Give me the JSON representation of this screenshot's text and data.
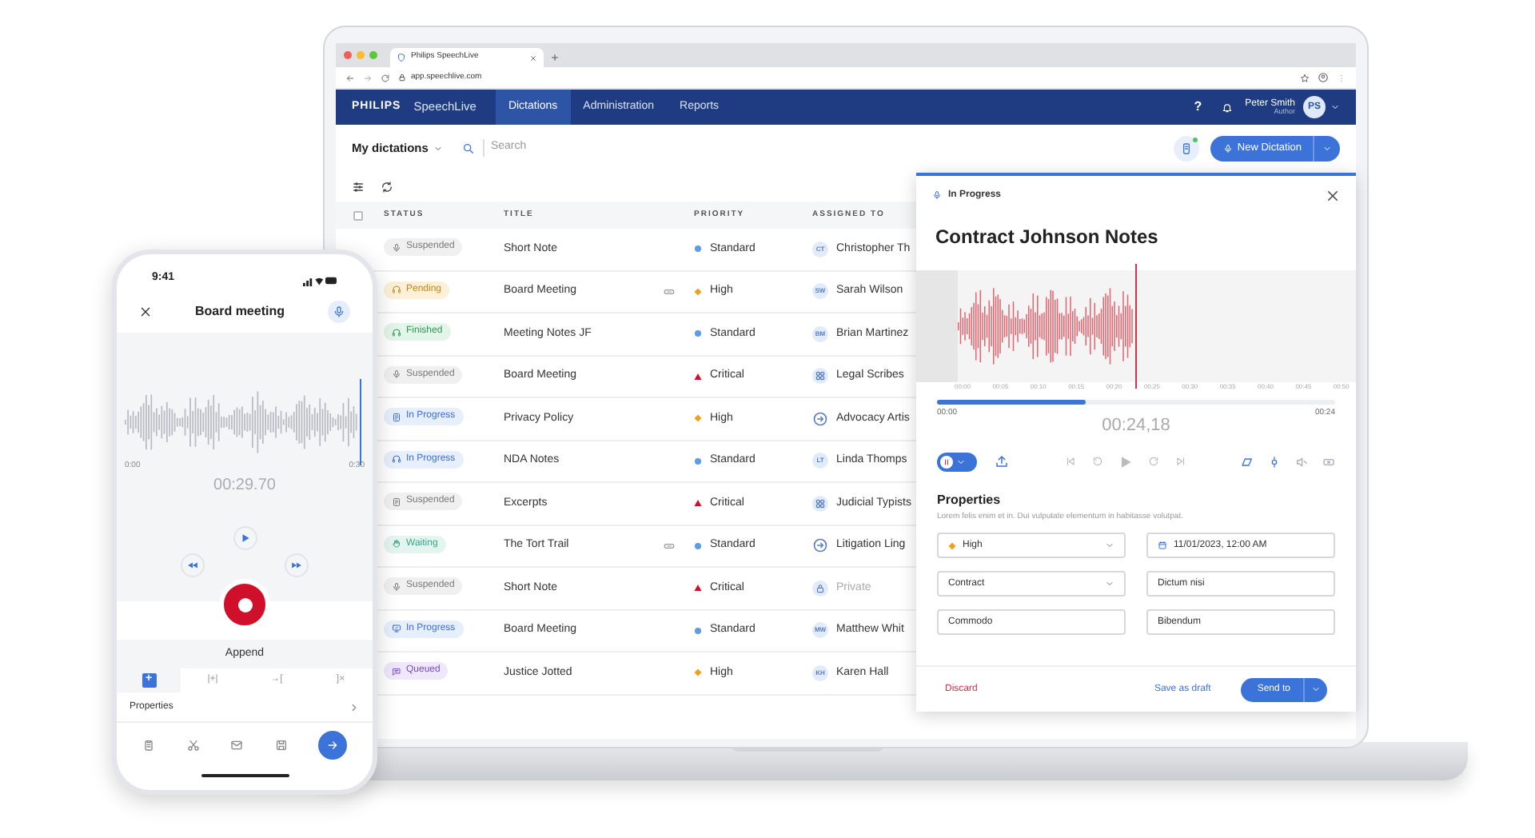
{
  "browser": {
    "tab_title": "Philips SpeechLive",
    "url": "app.speechlive.com"
  },
  "app_header": {
    "brand": "PHILIPS",
    "product": "SpeechLive",
    "nav": [
      {
        "label": "Dictations",
        "selected": true
      },
      {
        "label": "Administration",
        "selected": false
      },
      {
        "label": "Reports",
        "selected": false
      }
    ],
    "help": "?",
    "user": {
      "name": "Peter Smith",
      "role": "Author",
      "initials": "PS"
    }
  },
  "toolbar": {
    "view": "My dictations",
    "search": {
      "placeholder": "Search"
    },
    "new_button": "New Dictation"
  },
  "table": {
    "columns": [
      "STATUS",
      "TITLE",
      "PRIORITY",
      "ASSIGNED TO"
    ],
    "select_all_checked": false,
    "rows": [
      {
        "status": {
          "label": "Suspended",
          "kind": "suspended"
        },
        "title": "Short Note",
        "attachment": false,
        "priority": {
          "label": "Standard",
          "kind": "standard"
        },
        "assignee": {
          "kind": "person",
          "initials": "CT",
          "name": "Christopher Th"
        }
      },
      {
        "status": {
          "label": "Pending",
          "kind": "pending"
        },
        "title": "Board Meeting",
        "attachment": true,
        "priority": {
          "label": "High",
          "kind": "high"
        },
        "assignee": {
          "kind": "person",
          "initials": "SW",
          "name": "Sarah Wilson"
        }
      },
      {
        "status": {
          "label": "Finished",
          "kind": "finished"
        },
        "title": "Meeting Notes JF",
        "attachment": false,
        "priority": {
          "label": "Standard",
          "kind": "standard"
        },
        "assignee": {
          "kind": "person",
          "initials": "BM",
          "name": "Brian Martinez"
        }
      },
      {
        "status": {
          "label": "Suspended",
          "kind": "suspended"
        },
        "title": "Board Meeting",
        "attachment": false,
        "priority": {
          "label": "Critical",
          "kind": "critical"
        },
        "assignee": {
          "kind": "group",
          "name": "Legal Scribes"
        }
      },
      {
        "status": {
          "label": "In Progress",
          "kind": "in_progress"
        },
        "title": "Privacy Policy",
        "attachment": false,
        "priority": {
          "label": "High",
          "kind": "high"
        },
        "assignee": {
          "kind": "service",
          "name": "Advocacy Artis"
        }
      },
      {
        "status": {
          "label": "In Progress",
          "kind": "in_progress"
        },
        "title": "NDA Notes",
        "attachment": false,
        "priority": {
          "label": "Standard",
          "kind": "standard"
        },
        "assignee": {
          "kind": "person",
          "initials": "LT",
          "name": "Linda Thomps"
        }
      },
      {
        "status": {
          "label": "Suspended",
          "kind": "suspended"
        },
        "title": "Excerpts",
        "attachment": false,
        "priority": {
          "label": "Critical",
          "kind": "critical"
        },
        "assignee": {
          "kind": "group",
          "name": "Judicial Typists"
        }
      },
      {
        "status": {
          "label": "Waiting",
          "kind": "waiting"
        },
        "title": "The Tort Trail",
        "attachment": true,
        "priority": {
          "label": "Standard",
          "kind": "standard"
        },
        "assignee": {
          "kind": "service",
          "name": "Litigation Ling"
        }
      },
      {
        "status": {
          "label": "Suspended",
          "kind": "suspended"
        },
        "title": "Short Note",
        "attachment": false,
        "priority": {
          "label": "Critical",
          "kind": "critical"
        },
        "assignee": {
          "kind": "private",
          "name": "Private"
        }
      },
      {
        "status": {
          "label": "In Progress",
          "kind": "in_progress"
        },
        "title": "Board Meeting",
        "attachment": false,
        "priority": {
          "label": "Standard",
          "kind": "standard"
        },
        "assignee": {
          "kind": "person",
          "initials": "MW",
          "name": "Matthew Whit"
        }
      },
      {
        "status": {
          "label": "Queued",
          "kind": "queued"
        },
        "title": "Justice Jotted",
        "attachment": false,
        "priority": {
          "label": "High",
          "kind": "high"
        },
        "assignee": {
          "kind": "person",
          "initials": "KH",
          "name": "Karen Hall"
        }
      }
    ]
  },
  "panel": {
    "status": "In Progress",
    "title": "Contract Johnson Notes",
    "ticks": [
      "00:00",
      "00:05",
      "00:10",
      "00:15",
      "00:20",
      "00:25",
      "00:30",
      "00:35",
      "00:40",
      "00:45",
      "00:50"
    ],
    "recording": true,
    "progress": {
      "level": 0.375
    },
    "start": "00:00",
    "current": "00:24,18",
    "end": "00:24",
    "properties": {
      "heading": "Properties",
      "description": "Lorem felis enim et in. Dui vulputate elementum in habitasse volutpat.",
      "fields": [
        {
          "kind": "priority_select",
          "value": "High"
        },
        {
          "kind": "date",
          "value": "11/01/2023, 12:00 AM"
        },
        {
          "kind": "select",
          "value": "Contract"
        },
        {
          "kind": "text",
          "value": "Dictum nisi"
        },
        {
          "kind": "text",
          "value": "Commodo"
        },
        {
          "kind": "text",
          "value": "Bibendum"
        }
      ]
    },
    "footer": {
      "discard": "Discard",
      "save": "Save as draft",
      "send": "Send to"
    }
  },
  "phone": {
    "time": "9:41",
    "title": "Board meeting",
    "start": "0:00",
    "end": "0:30",
    "position": "00:29.70",
    "mode": "Append",
    "modes": [
      {
        "label": "+",
        "selected": true
      },
      {
        "label": "|+|",
        "selected": false
      },
      {
        "label": "→[",
        "selected": false
      },
      {
        "label": "]×",
        "selected": false
      }
    ],
    "properties": "Properties"
  }
}
